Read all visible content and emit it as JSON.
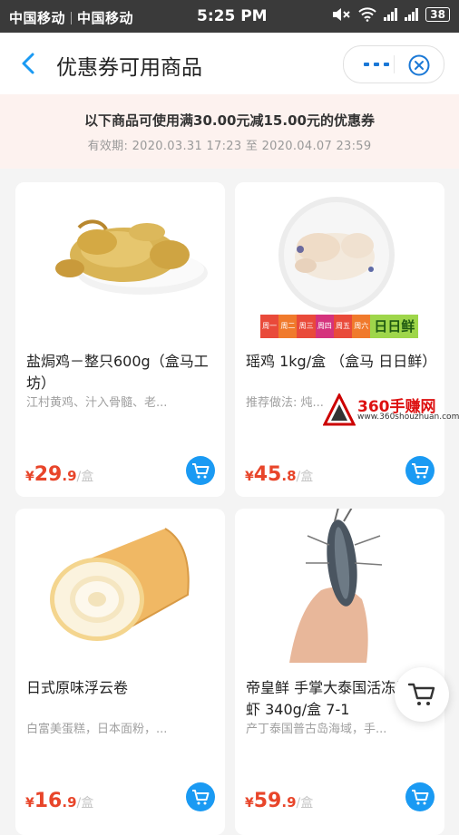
{
  "status_bar": {
    "carrier_1": "中国移动",
    "carrier_2": "中国移动",
    "time": "5:25 PM",
    "battery": "38"
  },
  "header": {
    "title": "优惠券可用商品"
  },
  "banner": {
    "text": "以下商品可使用满30.00元减15.00元的优惠券",
    "validity": "有效期: 2020.03.31 17:23 至 2020.04.07 23:59"
  },
  "products": [
    {
      "name": "盐焗鸡－整只600g（盒马工坊）",
      "desc": "江村黄鸡、汁入骨髓、老...",
      "price_symbol": "¥",
      "price_int": "29",
      "price_dec": ".9",
      "unit": "/盒"
    },
    {
      "name": "瑶鸡 1kg/盒 （盒马 日日鲜）",
      "desc": "推荐做法: 炖...",
      "price_symbol": "¥",
      "price_int": "45",
      "price_dec": ".8",
      "unit": "/盒",
      "badge_days": [
        "周一",
        "周二",
        "周三",
        "周四",
        "周五",
        "周六"
      ],
      "badge_brand": "日日鲜"
    },
    {
      "name": "日式原味浮云卷",
      "desc": "白富美蛋糕，日本面粉，...",
      "price_symbol": "¥",
      "price_int": "16",
      "price_dec": ".9",
      "unit": "/盒"
    },
    {
      "name": "帝皇鲜 手掌大泰国活冻黑虎虾 340g/盒 7-1",
      "desc": "产丁泰国普古岛海域，手...",
      "price_symbol": "¥",
      "price_int": "59",
      "price_dec": ".9",
      "unit": "/盒"
    }
  ],
  "watermark": {
    "name": "360手赚网",
    "url": "www.360shouzhuan.com"
  },
  "colors": {
    "accent": "#1a9af3",
    "price": "#e8452a",
    "banner_bg": "#fdf2ef",
    "status_bar": "#3a3a3a"
  },
  "icons": {
    "back": "chevron-left-icon",
    "more": "more-dots-icon",
    "close": "close-circle-icon",
    "cart": "cart-icon"
  }
}
